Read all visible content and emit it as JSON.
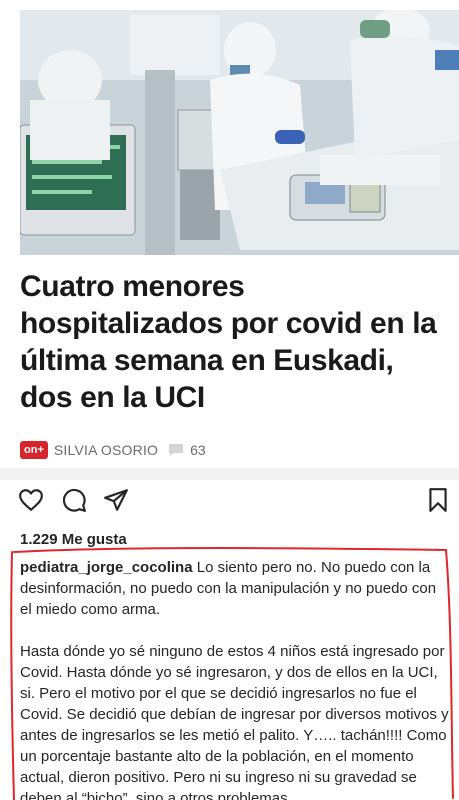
{
  "article": {
    "headline": "Cuatro menores hospitalizados por covid en la última semana en Euskadi, dos en la UCI",
    "badge": "on+",
    "author": "SILVIA OSORIO",
    "comment_count": "63"
  },
  "post": {
    "likes": "1.229 Me gusta",
    "username": "pediatra_jorge_cocolina",
    "caption_p1": " Lo siento pero no. No puedo con la desinformación, no puedo con la manipulación y no puedo con el miedo como arma.",
    "caption_p2": "Hasta dónde yo sé ninguno de estos 4 niños está ingresado por Covid. Hasta dónde yo sé ingresaron, y dos de ellos en la UCI, si. Pero el motivo por el que se decidió ingresarlos no fue el Covid. Se decidió que debían de ingresar por diversos motivos y antes de ingresarlos se les metió el palito. Y….. tachán!!!! Como un porcentaje bastante alto de la población, en el momento actual, dieron positivo. Pero ni su ingreso ni su gravedad se deben al “bicho”, sino a otros problemas."
  },
  "icons": {
    "like": "heart-icon",
    "comment": "comment-bubble-icon",
    "share": "paper-plane-icon",
    "save": "bookmark-icon",
    "byline_comment": "speech-bubble-icon"
  },
  "colors": {
    "badge_red": "#d7262b",
    "highlight_red": "#e0262f",
    "text": "#262626"
  }
}
